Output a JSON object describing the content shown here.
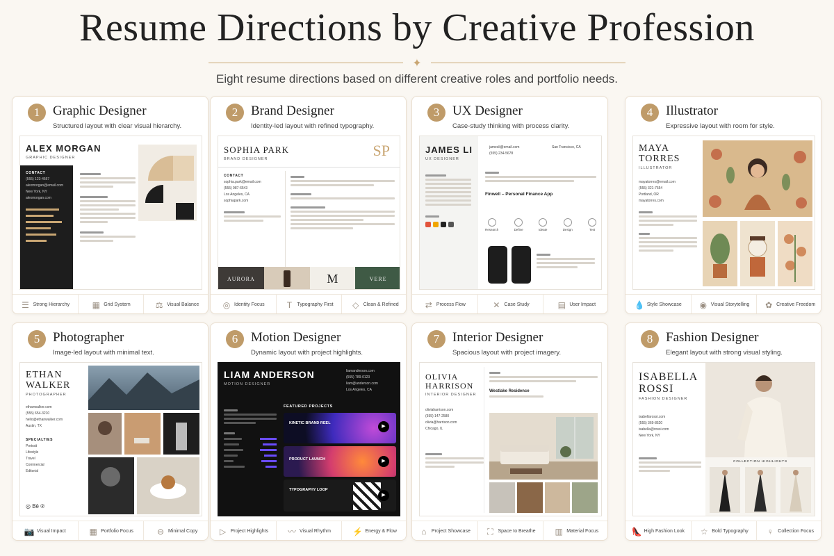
{
  "header": {
    "title": "Resume Directions by Creative Profession",
    "subtitle": "Eight resume directions based on different creative roles and portfolio needs."
  },
  "colors": {
    "accent": "#bf9b69",
    "background": "#faf7f2"
  },
  "cards": [
    {
      "num": "1",
      "title": "Graphic Designer",
      "desc": "Structured layout with clear visual hierarchy.",
      "resume": {
        "name": "ALEX MORGAN",
        "role": "GRAPHIC DESIGNER",
        "contact": [
          "(555) 123-4567",
          "alexmorgan@email.com",
          "New York, NY",
          "alexmorgan.com"
        ]
      },
      "features": [
        {
          "icon": "hierarchy-icon",
          "label": "Strong Hierarchy"
        },
        {
          "icon": "grid-icon",
          "label": "Grid System"
        },
        {
          "icon": "balance-icon",
          "label": "Visual Balance"
        }
      ]
    },
    {
      "num": "2",
      "title": "Brand Designer",
      "desc": "Identity-led layout with refined typography.",
      "resume": {
        "name": "SOPHIA PARK",
        "role": "BRAND DESIGNER",
        "monogram": "SP",
        "contact": [
          "sophia.park@email.com",
          "(555) 987-6543",
          "Los Angeles, CA",
          "sophiapark.com"
        ],
        "brands": [
          "AURORA",
          "M",
          "VERE"
        ]
      },
      "features": [
        {
          "icon": "target-icon",
          "label": "Identity Focus"
        },
        {
          "icon": "typography-icon",
          "label": "Typography First"
        },
        {
          "icon": "diamond-icon",
          "label": "Clean & Refined"
        }
      ]
    },
    {
      "num": "3",
      "title": "UX Designer",
      "desc": "Case-study thinking with process clarity.",
      "resume": {
        "name": "JAMES LI",
        "role": "UX DESIGNER",
        "contact": [
          "jamesli@email.com",
          "(555) 234-5678",
          "San Francisco, CA"
        ],
        "project": "Finwell – Personal Finance App",
        "steps": [
          "Research",
          "Define",
          "Ideate",
          "Design",
          "Test"
        ]
      },
      "features": [
        {
          "icon": "flow-icon",
          "label": "Process Flow"
        },
        {
          "icon": "case-study-icon",
          "label": "Case Study"
        },
        {
          "icon": "chart-icon",
          "label": "User Impact"
        }
      ]
    },
    {
      "num": "4",
      "title": "Illustrator",
      "desc": "Expressive layout with room for style.",
      "resume": {
        "name": "MAYA TORRES",
        "role": "ILLUSTRATOR",
        "contact": [
          "mayatorres@email.com",
          "(555) 321-7654",
          "Portland, OR",
          "mayatorres.com"
        ]
      },
      "features": [
        {
          "icon": "drop-icon",
          "label": "Style Showcase"
        },
        {
          "icon": "eye-icon",
          "label": "Visual Storytelling"
        },
        {
          "icon": "palette-icon",
          "label": "Creative Freedom"
        }
      ]
    },
    {
      "num": "5",
      "title": "Photographer",
      "desc": "Image-led layout with minimal text.",
      "resume": {
        "name": "ETHAN WALKER",
        "role": "PHOTOGRAPHER",
        "contact": [
          "ethanwalker.com",
          "(555) 654-3210",
          "hello@ethanwalker.com",
          "Austin, TX"
        ],
        "specialties_title": "SPECIALTIES",
        "specialties": [
          "Portrait",
          "Lifestyle",
          "Travel",
          "Commercial",
          "Editorial"
        ]
      },
      "features": [
        {
          "icon": "camera-icon",
          "label": "Visual Impact"
        },
        {
          "icon": "grid-icon",
          "label": "Portfolio Focus"
        },
        {
          "icon": "minus-icon",
          "label": "Minimal Copy"
        }
      ]
    },
    {
      "num": "6",
      "title": "Motion Designer",
      "desc": "Dynamic layout with project highlights.",
      "resume": {
        "name": "LIAM ANDERSON",
        "role": "MOTION DESIGNER",
        "contact": [
          "liamanderson.com",
          "(555) 789-0123",
          "liam@anderson.com",
          "Los Angeles, CA"
        ],
        "projects_title": "FEATURED PROJECTS",
        "projects": [
          "KINETIC BRAND REEL",
          "PRODUCT LAUNCH",
          "TYPOGRAPHY LOOP"
        ]
      },
      "features": [
        {
          "icon": "play-icon",
          "label": "Project Highlights"
        },
        {
          "icon": "waveform-icon",
          "label": "Visual Rhythm"
        },
        {
          "icon": "bolt-icon",
          "label": "Energy & Flow"
        }
      ]
    },
    {
      "num": "7",
      "title": "Interior Designer",
      "desc": "Spacious layout with project imagery.",
      "resume": {
        "name": "OLIVIA HARRISON",
        "role": "INTERIOR DESIGNER",
        "contact": [
          "oliviaharrison.com",
          "(555) 147-2580",
          "olivia@harrison.com",
          "Chicago, IL"
        ],
        "project": "Westlake Residence"
      },
      "features": [
        {
          "icon": "armchair-icon",
          "label": "Project Showcase"
        },
        {
          "icon": "expand-icon",
          "label": "Space to Breathe"
        },
        {
          "icon": "swatch-icon",
          "label": "Material Focus"
        }
      ]
    },
    {
      "num": "8",
      "title": "Fashion Designer",
      "desc": "Elegant layout with strong visual styling.",
      "resume": {
        "name": "ISABELLA ROSSI",
        "role": "FASHION DESIGNER",
        "contact": [
          "isabellarossi.com",
          "(555) 369-8520",
          "isabella@rossi.com",
          "New York, NY"
        ],
        "highlights": "COLLECTION HIGHLIGHTS"
      },
      "features": [
        {
          "icon": "heel-icon",
          "label": "High Fashion Look"
        },
        {
          "icon": "star-icon",
          "label": "Bold Typography"
        },
        {
          "icon": "dress-icon",
          "label": "Collection Focus"
        }
      ]
    }
  ]
}
